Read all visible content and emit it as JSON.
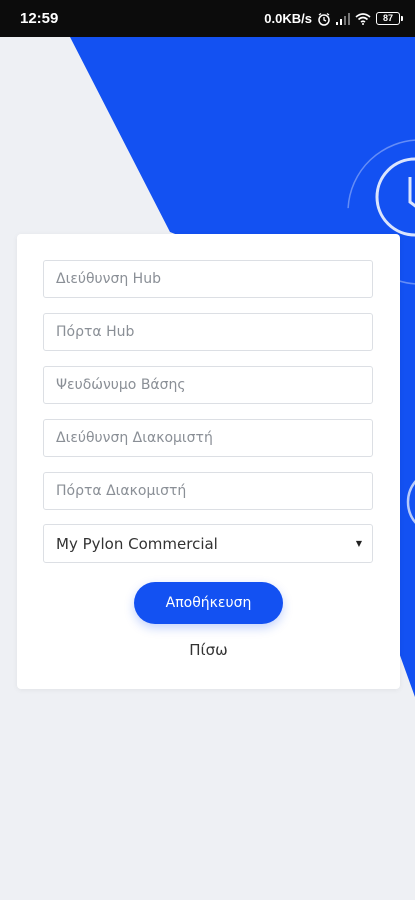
{
  "status_bar": {
    "time": "12:59",
    "net_speed": "0.0KB/s",
    "battery": "87",
    "icons": [
      "alarm-icon",
      "signal-icon",
      "wifi-icon",
      "battery-icon"
    ]
  },
  "form": {
    "fields": [
      {
        "placeholder": "Διεύθυνση Hub",
        "value": ""
      },
      {
        "placeholder": "Πόρτα Hub",
        "value": ""
      },
      {
        "placeholder": "Ψευδώνυμο Βάσης",
        "value": ""
      },
      {
        "placeholder": "Διεύθυνση Διακομιστή",
        "value": ""
      },
      {
        "placeholder": "Πόρτα Διακομιστή",
        "value": ""
      }
    ],
    "select": {
      "value": "My Pylon Commercial"
    },
    "save_label": "Αποθήκευση",
    "back_label": "Πίσω"
  },
  "theme": {
    "primary": "#1351f2",
    "background": "#eef0f4",
    "card": "#ffffff"
  }
}
